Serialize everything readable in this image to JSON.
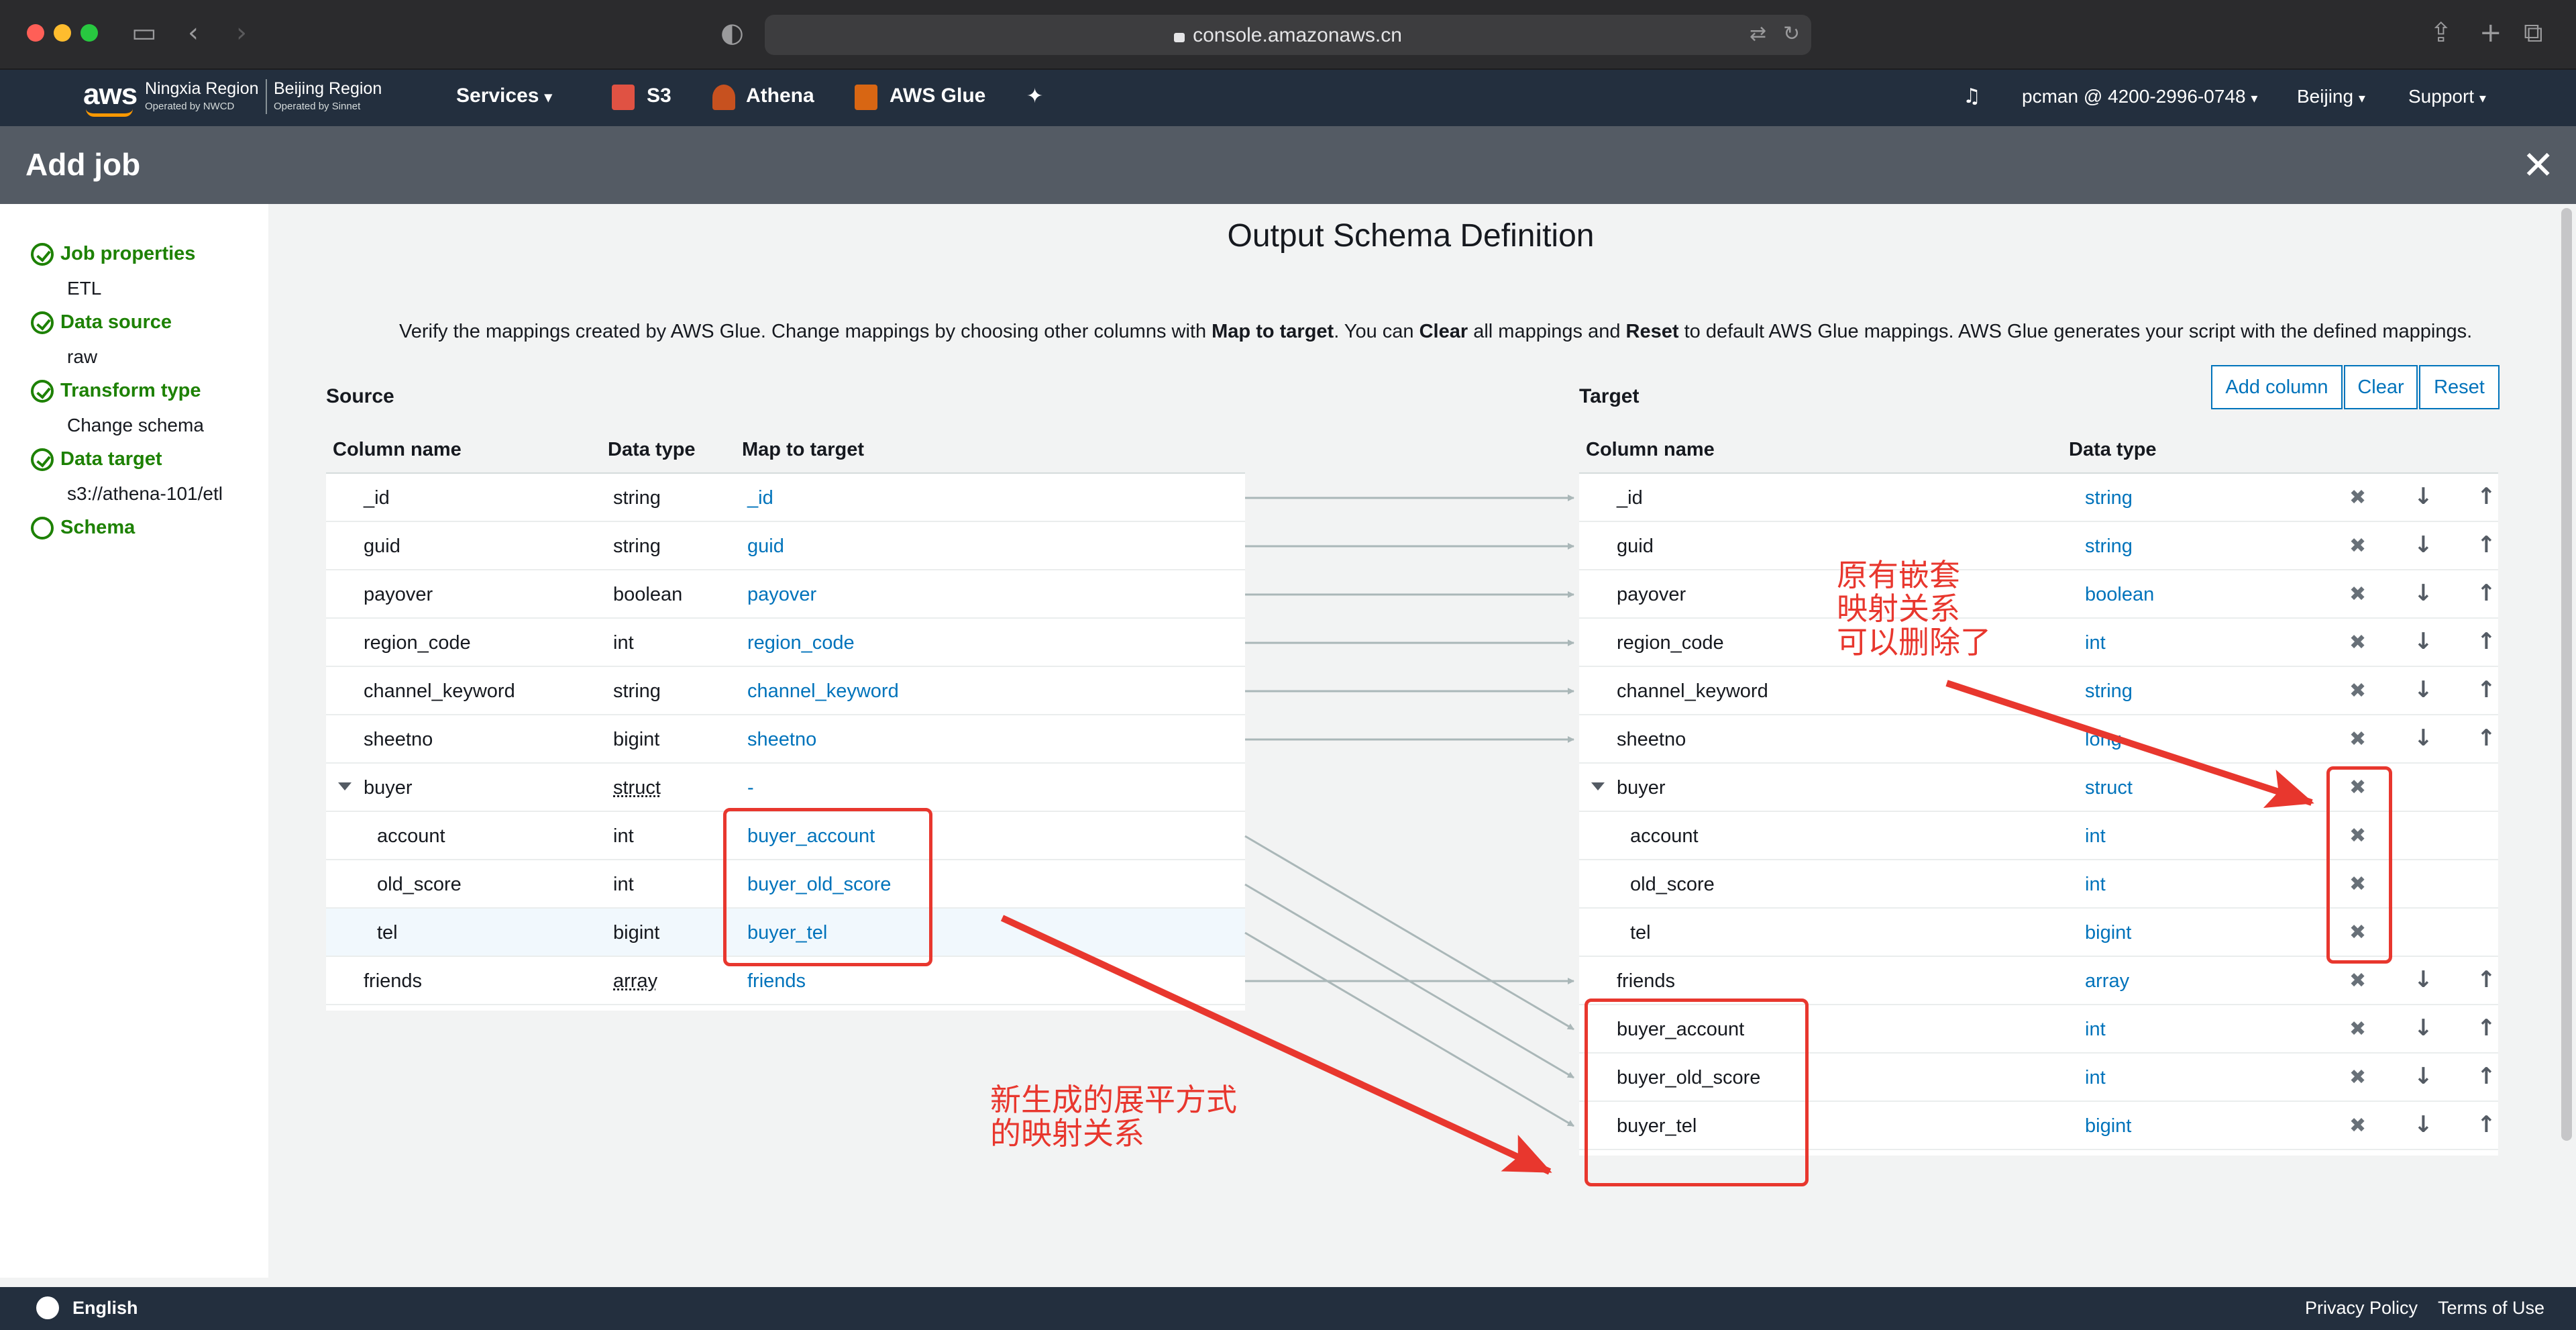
{
  "browser": {
    "url": "console.amazonaws.cn"
  },
  "nav": {
    "logo": "aws",
    "region1_name": "Ningxia Region",
    "region1_sub": "Operated by NWCD",
    "region2_name": "Beijing Region",
    "region2_sub": "Operated by Sinnet",
    "services": "Services",
    "s3": "S3",
    "athena": "Athena",
    "glue": "AWS Glue",
    "account": "pcman @ 4200-2996-0748",
    "region": "Beijing",
    "support": "Support"
  },
  "page": {
    "title": "Add job"
  },
  "sidebar": {
    "steps": [
      {
        "label": "Job properties",
        "value": "ETL"
      },
      {
        "label": "Data source",
        "value": "raw"
      },
      {
        "label": "Transform type",
        "value": "Change schema"
      },
      {
        "label": "Data target",
        "value": "s3://athena-101/etl"
      },
      {
        "label": "Schema"
      }
    ]
  },
  "main": {
    "title": "Output Schema Definition",
    "desc_1": "Verify the mappings created by AWS Glue. Change mappings by choosing other columns with ",
    "desc_b1": "Map to target",
    "desc_2": ". You can ",
    "desc_b2": "Clear",
    "desc_3": " all mappings and ",
    "desc_b3": "Reset",
    "desc_4": " to default AWS Glue mappings. AWS Glue generates your script with the defined mappings.",
    "source_title": "Source",
    "target_title": "Target",
    "add_column": "Add column",
    "clear": "Clear",
    "reset": "Reset"
  },
  "source": {
    "headers": {
      "name": "Column name",
      "type": "Data type",
      "map": "Map to target"
    },
    "rows": [
      {
        "name": "_id",
        "type": "string",
        "map": "_id"
      },
      {
        "name": "guid",
        "type": "string",
        "map": "guid"
      },
      {
        "name": "payover",
        "type": "boolean",
        "map": "payover"
      },
      {
        "name": "region_code",
        "type": "int",
        "map": "region_code"
      },
      {
        "name": "channel_keyword",
        "type": "string",
        "map": "channel_keyword"
      },
      {
        "name": "sheetno",
        "type": "bigint",
        "map": "sheetno"
      },
      {
        "name": "buyer",
        "type": "struct",
        "map": "-"
      },
      {
        "name": "account",
        "type": "int",
        "map": "buyer_account"
      },
      {
        "name": "old_score",
        "type": "int",
        "map": "buyer_old_score"
      },
      {
        "name": "tel",
        "type": "bigint",
        "map": "buyer_tel"
      },
      {
        "name": "friends",
        "type": "array",
        "map": "friends"
      }
    ]
  },
  "target": {
    "headers": {
      "name": "Column name",
      "type": "Data type"
    },
    "rows": [
      {
        "name": "_id",
        "type": "string"
      },
      {
        "name": "guid",
        "type": "string"
      },
      {
        "name": "payover",
        "type": "boolean"
      },
      {
        "name": "region_code",
        "type": "int"
      },
      {
        "name": "channel_keyword",
        "type": "string"
      },
      {
        "name": "sheetno",
        "type": "long"
      },
      {
        "name": "buyer",
        "type": "struct"
      },
      {
        "name": "account",
        "type": "int"
      },
      {
        "name": "old_score",
        "type": "int"
      },
      {
        "name": "tel",
        "type": "bigint"
      },
      {
        "name": "friends",
        "type": "array"
      },
      {
        "name": "buyer_account",
        "type": "int"
      },
      {
        "name": "buyer_old_score",
        "type": "int"
      },
      {
        "name": "buyer_tel",
        "type": "bigint"
      }
    ]
  },
  "annotations": {
    "nested": "原有嵌套\n映射关系\n可以删除了",
    "flat": "新生成的展平方式\n的映射关系"
  },
  "footer": {
    "language": "English",
    "privacy": "Privacy Policy",
    "terms": "Terms of Use"
  }
}
